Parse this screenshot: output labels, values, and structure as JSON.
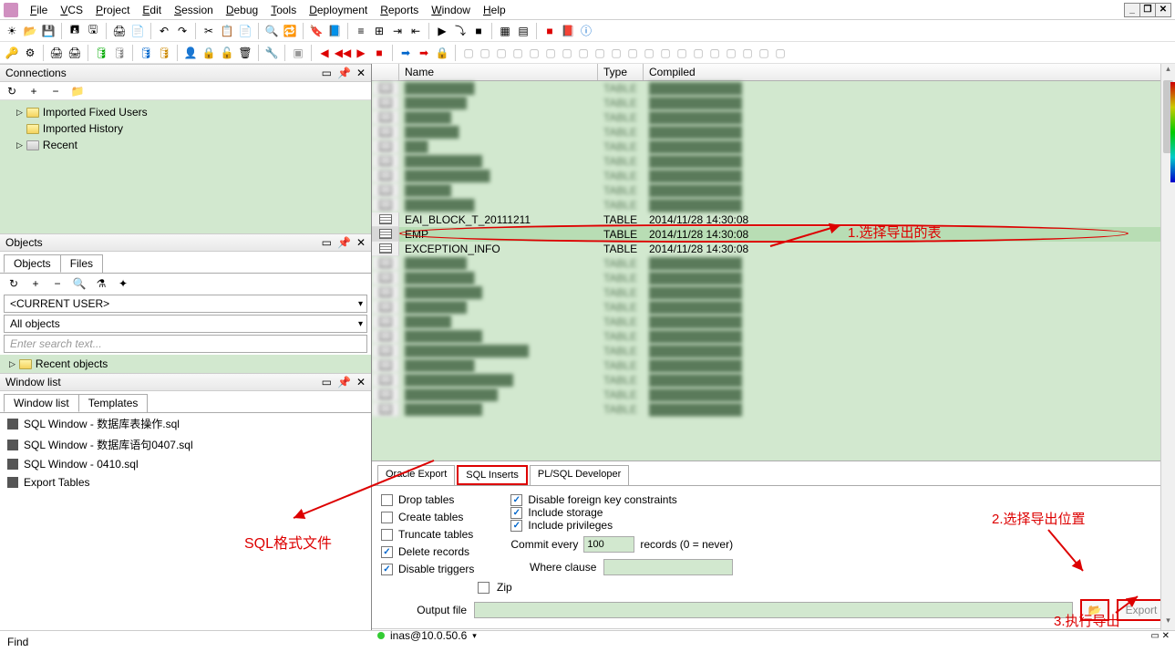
{
  "menubar": {
    "items": [
      "File",
      "VCS",
      "Project",
      "Edit",
      "Session",
      "Debug",
      "Tools",
      "Deployment",
      "Reports",
      "Window",
      "Help"
    ]
  },
  "left": {
    "connections": {
      "title": "Connections",
      "items": [
        "Imported Fixed Users",
        "Imported History",
        "Recent"
      ]
    },
    "objects": {
      "title": "Objects",
      "tabs": [
        "Objects",
        "Files"
      ],
      "user_combo": "<CURRENT USER>",
      "filter_combo": "All objects",
      "search_placeholder": "Enter search text...",
      "recent_label": "Recent objects"
    },
    "windowlist": {
      "title": "Window list",
      "tabs": [
        "Window list",
        "Templates"
      ],
      "items": [
        "SQL Window - 数据库表操作.sql",
        "SQL Window - 数据库语句0407.sql",
        "SQL Window - 0410.sql",
        "Export Tables"
      ]
    }
  },
  "grid": {
    "headers": [
      "",
      "Name",
      "Type",
      "Compiled"
    ],
    "rows": [
      {
        "name": "█████████",
        "type": "TABLE",
        "compiled": "████████████",
        "blur": true
      },
      {
        "name": "████████",
        "type": "TABLE",
        "compiled": "████████████",
        "blur": true
      },
      {
        "name": "██████",
        "type": "TABLE",
        "compiled": "████████████",
        "blur": true
      },
      {
        "name": "███████",
        "type": "TABLE",
        "compiled": "████████████",
        "blur": true
      },
      {
        "name": "███",
        "type": "TABLE",
        "compiled": "████████████",
        "blur": true
      },
      {
        "name": "██████████",
        "type": "TABLE",
        "compiled": "████████████",
        "blur": true
      },
      {
        "name": "███████████",
        "type": "TABLE",
        "compiled": "████████████",
        "blur": true
      },
      {
        "name": "██████",
        "type": "TABLE",
        "compiled": "████████████",
        "blur": true
      },
      {
        "name": "█████████",
        "type": "TABLE",
        "compiled": "████████████",
        "blur": true
      },
      {
        "name": "EAI_BLOCK_T_20111211",
        "type": "TABLE",
        "compiled": "2014/11/28 14:30:08",
        "blur": false
      },
      {
        "name": "EMP",
        "type": "TABLE",
        "compiled": "2014/11/28 14:30:08",
        "blur": false,
        "selected": true
      },
      {
        "name": "EXCEPTION_INFO",
        "type": "TABLE",
        "compiled": "2014/11/28 14:30:08",
        "blur": false
      },
      {
        "name": "████████",
        "type": "TABLE",
        "compiled": "████████████",
        "blur": true
      },
      {
        "name": "█████████",
        "type": "TABLE",
        "compiled": "████████████",
        "blur": true
      },
      {
        "name": "██████████",
        "type": "TABLE",
        "compiled": "████████████",
        "blur": true
      },
      {
        "name": "████████",
        "type": "TABLE",
        "compiled": "████████████",
        "blur": true
      },
      {
        "name": "██████",
        "type": "TABLE",
        "compiled": "████████████",
        "blur": true
      },
      {
        "name": "██████████",
        "type": "TABLE",
        "compiled": "████████████",
        "blur": true
      },
      {
        "name": "████████████████",
        "type": "TABLE",
        "compiled": "████████████",
        "blur": true
      },
      {
        "name": "█████████",
        "type": "TABLE",
        "compiled": "████████████",
        "blur": true
      },
      {
        "name": "██████████████",
        "type": "TABLE",
        "compiled": "████████████",
        "blur": true
      },
      {
        "name": "████████████",
        "type": "TABLE",
        "compiled": "████████████",
        "blur": true
      },
      {
        "name": "██████████",
        "type": "TABLE",
        "compiled": "████████████",
        "blur": true
      }
    ]
  },
  "export": {
    "tabs": [
      "Oracle Export",
      "SQL Inserts",
      "PL/SQL Developer"
    ],
    "active_tab": 1,
    "options_left": [
      {
        "label": "Drop tables",
        "checked": false
      },
      {
        "label": "Create tables",
        "checked": false
      },
      {
        "label": "Truncate tables",
        "checked": false
      },
      {
        "label": "Delete records",
        "checked": true
      },
      {
        "label": "Disable triggers",
        "checked": true
      }
    ],
    "options_right": [
      {
        "label": "Disable foreign key constraints",
        "checked": true
      },
      {
        "label": "Include storage",
        "checked": true
      },
      {
        "label": "Include privileges",
        "checked": true
      }
    ],
    "commit_label": "Commit every",
    "commit_value": "100",
    "commit_suffix": "records (0 = never)",
    "zip_label": "Zip",
    "where_label": "Where clause",
    "output_label": "Output file",
    "export_button": "Export",
    "status": "inas@10.0.50.6"
  },
  "find": {
    "label": "Find"
  },
  "annotations": {
    "a1": "1.选择导出的表",
    "a2": "2.选择导出位置",
    "a3": "3.执行导出",
    "sql": "SQL格式文件"
  }
}
